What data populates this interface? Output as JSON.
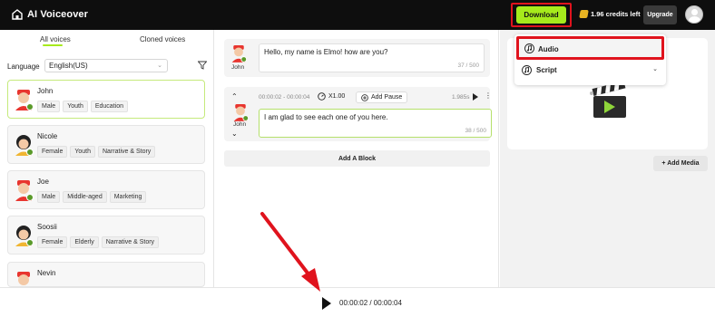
{
  "app": {
    "title": "AI Voiceover"
  },
  "header": {
    "download_label": "Download",
    "credits": "1.96 credits left",
    "upgrade_label": "Upgrade"
  },
  "left": {
    "tabs": [
      "All voices",
      "Cloned voices"
    ],
    "language_label": "Language",
    "language_value": "English(US)",
    "voices": [
      {
        "name": "John",
        "tags": [
          "Male",
          "Youth",
          "Education"
        ],
        "selected": true
      },
      {
        "name": "Nicole",
        "tags": [
          "Female",
          "Youth",
          "Narrative & Story"
        ]
      },
      {
        "name": "Joe",
        "tags": [
          "Male",
          "Middle-aged",
          "Marketing"
        ]
      },
      {
        "name": "Soosii",
        "tags": [
          "Female",
          "Elderly",
          "Narrative & Story"
        ]
      },
      {
        "name": "Nevin",
        "tags": []
      }
    ]
  },
  "center": {
    "block1": {
      "speaker": "John",
      "text": "Hello, my name is Elmo! how are you?",
      "count": "37 / 500"
    },
    "block2": {
      "speaker": "John",
      "range": "00:00:02 - 00:00:04",
      "speed": "X1.00",
      "add_pause": "Add Pause",
      "duration": "1.985s",
      "text": "I am glad to see each one of you here.",
      "count": "38 / 500"
    },
    "add_block_label": "Add A Block"
  },
  "right": {
    "dropdown": {
      "audio_label": "Audio",
      "script_label": "Script"
    },
    "add_media_label": "Add Media"
  },
  "player": {
    "time": "00:00:02 / 00:00:04"
  },
  "colors": {
    "accent": "#a6ea1c",
    "highlight": "#e0131d",
    "topbar": "#0e0e0e"
  },
  "icons": [
    "home-icon",
    "coin-icon",
    "filter-icon",
    "music-note-icon",
    "chevron-down-icon",
    "speed-icon",
    "add-icon",
    "play-icon",
    "more-icon",
    "clapperboard-icon"
  ]
}
